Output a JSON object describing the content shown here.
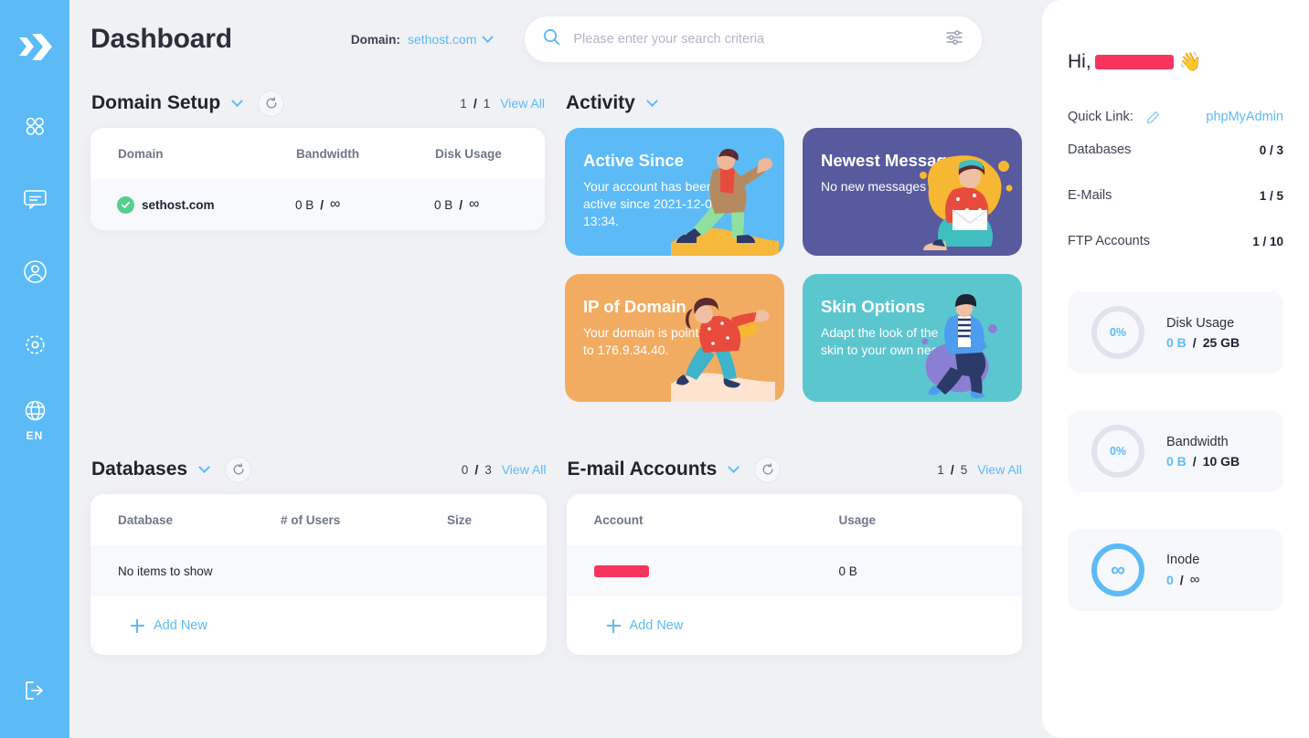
{
  "sidebar": {
    "logo": "double-chevron-logo",
    "items": [
      {
        "icon": "grid-apps-icon",
        "name": "apps"
      },
      {
        "icon": "message-icon",
        "name": "messages"
      },
      {
        "icon": "user-circle-icon",
        "name": "account"
      },
      {
        "icon": "gear-icon",
        "name": "settings"
      }
    ],
    "language": {
      "icon": "globe-icon",
      "label": "EN"
    },
    "logout": {
      "icon": "logout-icon"
    }
  },
  "header": {
    "title": "Dashboard",
    "domain_label": "Domain:",
    "domain_value": "sethost.com",
    "domain_chevron": "chevron-down-icon"
  },
  "search": {
    "icon": "search-icon",
    "placeholder": "Please enter your search criteria",
    "value": "",
    "filter_icon": "sliders-icon"
  },
  "domain_setup": {
    "title": "Domain Setup",
    "chevron": "chevron-down-icon",
    "refresh_icon": "refresh-icon",
    "count_current": "1",
    "count_sep": "/",
    "count_total": "1",
    "view_all": "View All",
    "columns": [
      "Domain",
      "Bandwidth",
      "Disk Usage"
    ],
    "rows": [
      {
        "status_icon": "check-circle-icon",
        "domain": "sethost.com",
        "bandwidth_used": "0 B",
        "bandwidth_sep": "/",
        "bandwidth_total": "∞",
        "disk_used": "0 B",
        "disk_sep": "/",
        "disk_total": "∞"
      }
    ]
  },
  "activity": {
    "title": "Activity",
    "chevron": "chevron-down-icon",
    "cards": [
      {
        "name": "active-since",
        "title": "Active Since",
        "desc": "Your account has been active since 2021-12-04 13:34.",
        "color": "#5cbbf6",
        "art": "runner-illustration"
      },
      {
        "name": "newest-message",
        "title": "Newest Message",
        "desc": "No new messages",
        "color": "#575a9c",
        "art": "letter-reader-illustration"
      },
      {
        "name": "ip-of-domain",
        "title": "IP of Domain",
        "desc": "Your domain is pointing to 176.9.34.40.",
        "color": "#f2ac62",
        "art": "kneeling-woman-illustration"
      },
      {
        "name": "skin-options",
        "title": "Skin Options",
        "desc": "Adapt the look of the skin to your own needs.",
        "color": "#5cc6cf",
        "art": "standing-man-illustration"
      }
    ]
  },
  "databases": {
    "title": "Databases",
    "chevron": "chevron-down-icon",
    "refresh_icon": "refresh-icon",
    "count_current": "0",
    "count_sep": "/",
    "count_total": "3",
    "view_all": "View All",
    "columns": [
      "Database",
      "# of Users",
      "Size"
    ],
    "empty_text": "No items to show",
    "add_new": "Add New",
    "add_icon": "plus-icon"
  },
  "email_accounts": {
    "title": "E-mail Accounts",
    "chevron": "chevron-down-icon",
    "refresh_icon": "refresh-icon",
    "count_current": "1",
    "count_sep": "/",
    "count_total": "5",
    "view_all": "View All",
    "columns": [
      "Account",
      "Usage"
    ],
    "rows": [
      {
        "account": "",
        "account_redacted": true,
        "usage": "0 B"
      }
    ],
    "add_new": "Add New",
    "add_icon": "plus-icon"
  },
  "right_panel": {
    "greeting_prefix": "Hi,",
    "greeting_name": "",
    "greeting_name_redacted": true,
    "wave_icon": "waving-hand-icon",
    "quick_link_label": "Quick Link:",
    "quick_link_edit_icon": "pencil-icon",
    "quick_link_value": "phpMyAdmin",
    "stats": [
      {
        "label": "Databases",
        "value": "0 / 3"
      },
      {
        "label": "E-Mails",
        "value": "1 / 5"
      },
      {
        "label": "FTP Accounts",
        "value": "1 / 10"
      }
    ],
    "usage": [
      {
        "name": "disk-usage",
        "ring_text": "0%",
        "ring_full": false,
        "label": "Disk Usage",
        "used": "0 B",
        "sep": "/",
        "total": "25 GB"
      },
      {
        "name": "bandwidth",
        "ring_text": "0%",
        "ring_full": false,
        "label": "Bandwidth",
        "used": "0 B",
        "sep": "/",
        "total": "10 GB"
      },
      {
        "name": "inode",
        "ring_text": "∞",
        "ring_full": true,
        "label": "Inode",
        "used": "0",
        "sep": "/",
        "total": "∞"
      }
    ]
  },
  "colors": {
    "accent": "#5cbbf6",
    "page_bg": "#f0f1f5",
    "card_bg": "#ffffff",
    "row_bg": "#f8f9fc",
    "success": "#55cf8e",
    "redact": "#f6345e",
    "purple": "#575a9c",
    "orange": "#f2ac62",
    "teal": "#5cc6cf"
  }
}
